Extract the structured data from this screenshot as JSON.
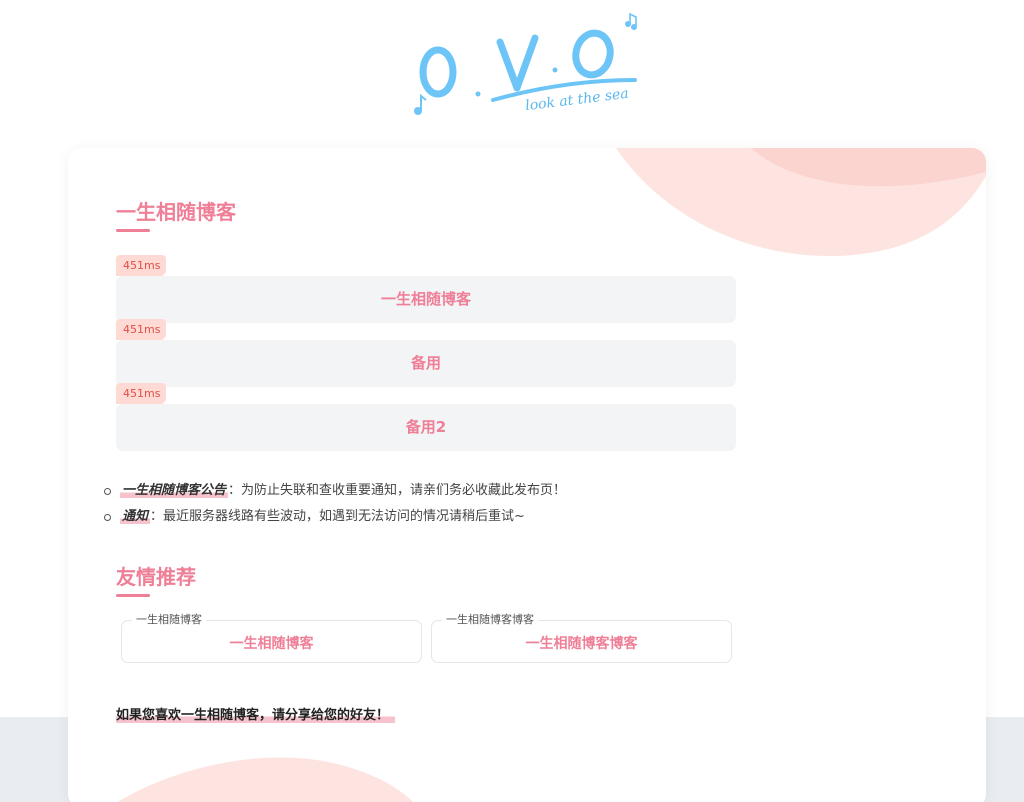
{
  "logo": {
    "text": "O.V.O",
    "tagline": "look at the sea"
  },
  "main": {
    "title": "一生相随博客",
    "links": [
      {
        "latency": "451ms",
        "label": "一生相随博客"
      },
      {
        "latency": "451ms",
        "label": "备用"
      },
      {
        "latency": "451ms",
        "label": "备用2"
      }
    ],
    "notices": [
      {
        "key": "一生相随博客公告",
        "sep": "：",
        "text": "为防止失联和查收重要通知，请亲们务必收藏此发布页！"
      },
      {
        "key": "通知",
        "sep": "：",
        "text": "最近服务器线路有些波动，如遇到无法访问的情况请稍后重试~"
      }
    ]
  },
  "friends": {
    "title": "友情推荐",
    "items": [
      {
        "legend": "一生相随博客",
        "name": "一生相随博客"
      },
      {
        "legend": "一生相随博客博客",
        "name": "一生相随博客博客"
      }
    ]
  },
  "share": {
    "text": "如果您喜欢一生相随博客，请分享给您的好友！"
  },
  "colors": {
    "accent": "#ef7f97",
    "latency_bg": "#ffd9d4",
    "logo_blue": "#6cc4f7"
  }
}
